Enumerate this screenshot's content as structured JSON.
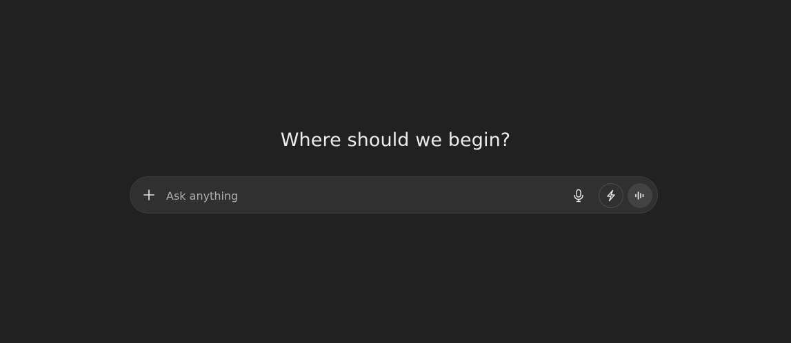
{
  "main": {
    "heading": "Where should we begin?"
  },
  "composer": {
    "placeholder": "Ask anything",
    "value": "",
    "icons": {
      "attach": "plus-icon",
      "dictate": "microphone-icon",
      "tools": "lightning-icon",
      "voice_mode": "voice-waveform-icon"
    }
  },
  "colors": {
    "background": "#212121",
    "composer_background": "#303030",
    "text": "#ececec",
    "placeholder": "#afafaf",
    "voice_button": "#424242"
  }
}
